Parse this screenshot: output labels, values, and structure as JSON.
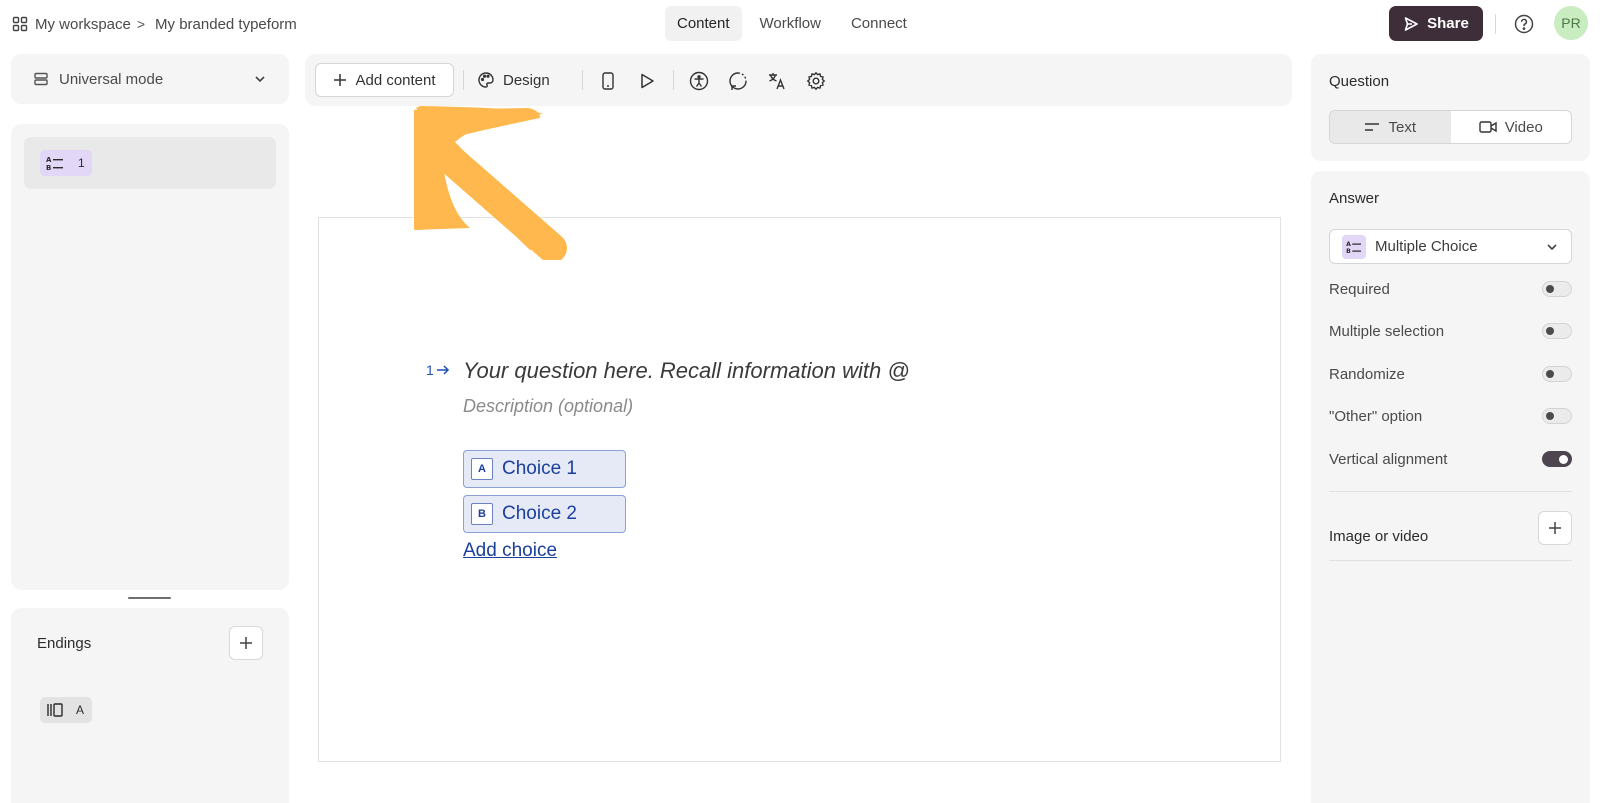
{
  "header": {
    "workspace": "My workspace",
    "separator": ">",
    "form_name": "My branded typeform",
    "tabs": [
      {
        "label": "Content",
        "active": true
      },
      {
        "label": "Workflow",
        "active": false
      },
      {
        "label": "Connect",
        "active": false
      }
    ],
    "share_label": "Share",
    "avatar_initials": "PR"
  },
  "left": {
    "mode_label": "Universal mode",
    "questions": [
      {
        "number": "1",
        "icon": "multiple-choice-icon"
      }
    ],
    "endings_title": "Endings",
    "endings": [
      {
        "letter": "A",
        "icon": "ending-icon"
      }
    ]
  },
  "toolbar": {
    "add_content_label": "Add content",
    "design_label": "Design",
    "icons": [
      "mobile-preview-icon",
      "play-icon",
      "accessibility-icon",
      "logic-icon",
      "translate-icon",
      "settings-icon"
    ]
  },
  "canvas": {
    "question_number": "1",
    "question_placeholder": "Your question here. Recall information with @",
    "description_placeholder": "Description (optional)",
    "choices": [
      {
        "key": "A",
        "label": "Choice 1"
      },
      {
        "key": "B",
        "label": "Choice 2"
      }
    ],
    "add_choice_label": "Add choice"
  },
  "right": {
    "question_title": "Question",
    "question_type_options": [
      {
        "label": "Text",
        "active": true
      },
      {
        "label": "Video",
        "active": false
      }
    ],
    "answer_title": "Answer",
    "answer_type": "Multiple Choice",
    "options": [
      {
        "label": "Required",
        "on": false
      },
      {
        "label": "Multiple selection",
        "on": false
      },
      {
        "label": "Randomize",
        "on": false
      },
      {
        "label": "\"Other\" option",
        "on": false
      },
      {
        "label": "Vertical alignment",
        "on": true
      }
    ],
    "image_video_label": "Image or video"
  },
  "colors": {
    "share_bg": "#3d2e3a",
    "choice_blue": "#1a3f9d",
    "arrow_orange": "#ffb84d",
    "question_badge": "#e2d7f7"
  }
}
